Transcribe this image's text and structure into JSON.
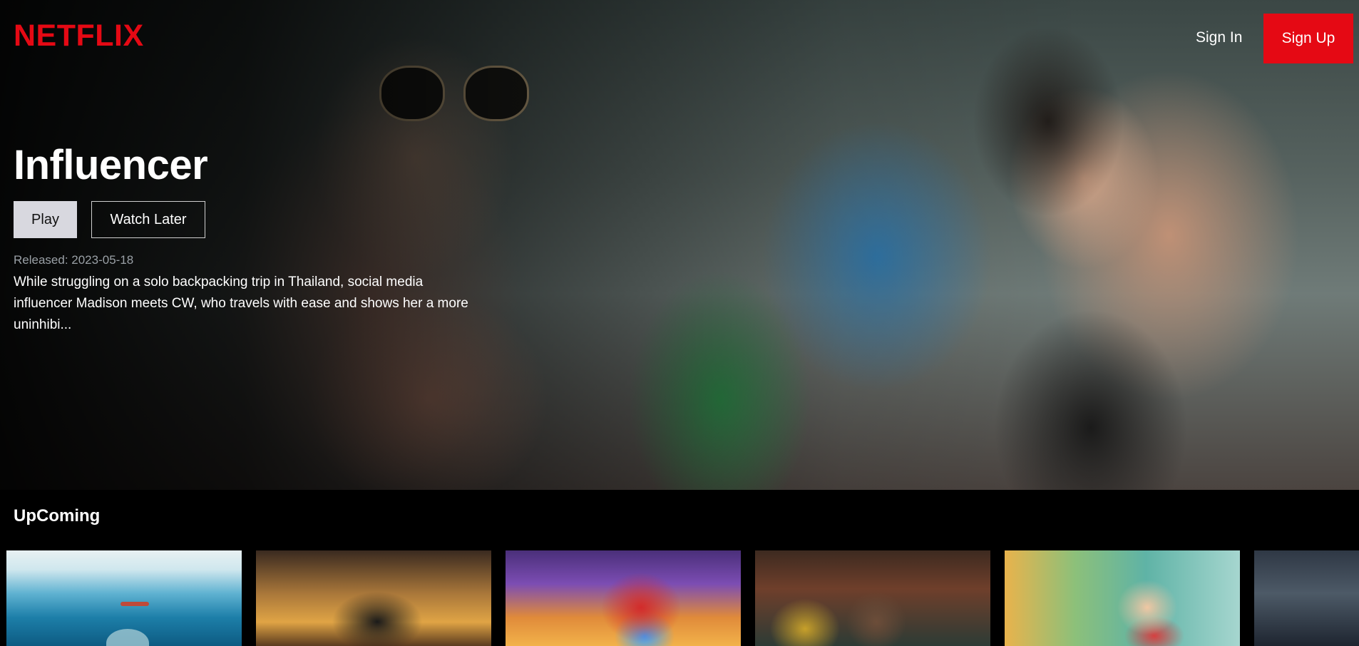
{
  "brand": {
    "logo": "NETFLIX",
    "accent": "#e50914"
  },
  "nav": {
    "sign_in": "Sign In",
    "sign_up": "Sign Up"
  },
  "hero": {
    "title": "Influencer",
    "play_label": "Play",
    "watch_later_label": "Watch Later",
    "released": "Released: 2023-05-18",
    "overview": "While struggling on a solo backpacking trip in Thailand, social media influencer Madison meets CW, who travels with ease and shows her a more uninhibi..."
  },
  "upcoming": {
    "title": "UpComing",
    "items": [
      {
        "thumb": "ocean-swimmer-shark"
      },
      {
        "thumb": "animated-kids-reading"
      },
      {
        "thumb": "robots-sunset"
      },
      {
        "thumb": "three-people-colorful"
      },
      {
        "thumb": "animated-girl-painting"
      },
      {
        "thumb": "house-dark-sky"
      }
    ]
  }
}
